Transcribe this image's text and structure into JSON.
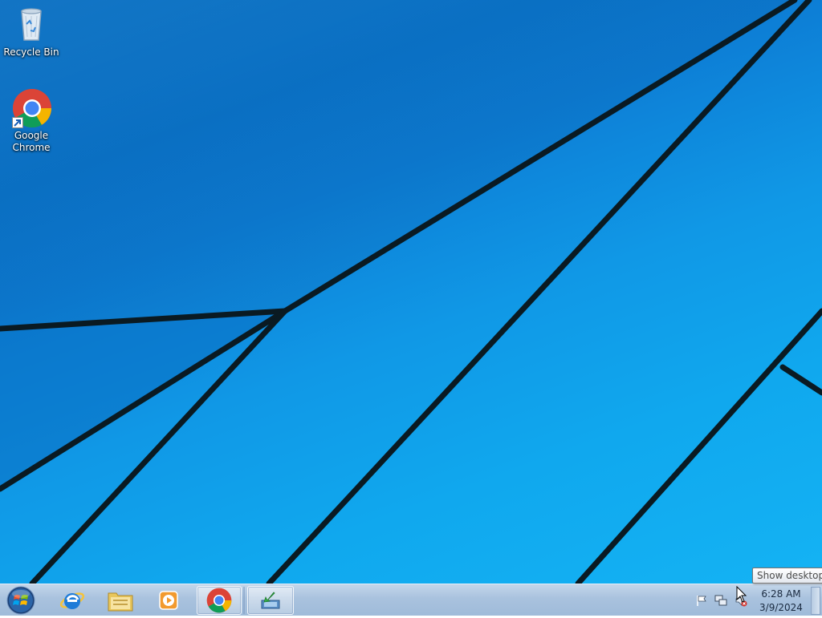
{
  "desktop": {
    "icons": [
      {
        "label": "Recycle Bin",
        "icon": "recycle-bin-icon"
      },
      {
        "label": "Google\nChrome",
        "icon": "chrome-icon"
      }
    ]
  },
  "taskbar": {
    "start": {
      "icon": "windows-start-orb-icon"
    },
    "pinned": [
      {
        "name": "Internet Explorer",
        "icon": "internet-explorer-icon"
      },
      {
        "name": "Windows Explorer",
        "icon": "folder-icon"
      },
      {
        "name": "Windows Media Player",
        "icon": "media-player-icon"
      },
      {
        "name": "Google Chrome",
        "icon": "chrome-icon",
        "active": true
      },
      {
        "name": "Installer",
        "icon": "install-arrow-icon"
      }
    ],
    "tray": {
      "icons": [
        "action-center-flag-icon",
        "network-icon",
        "volume-muted-icon"
      ],
      "time": "6:28 AM",
      "date": "3/9/2024"
    },
    "show_desktop_tooltip": "Show desktop"
  },
  "colors": {
    "wallpaper_blue": "#0d86db",
    "taskbar": "#b0c7e0"
  }
}
